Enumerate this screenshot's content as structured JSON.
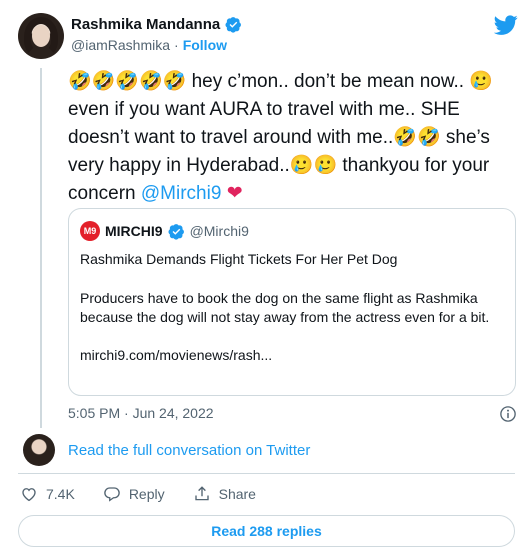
{
  "author": {
    "name": "Rashmika Mandanna",
    "handle": "@iamRashmika",
    "separator": "·",
    "follow_label": "Follow"
  },
  "tweet": {
    "line1_emoji": "🤣🤣🤣🤣🤣",
    "line1_text": " hey c’mon.. don’t be mean now.. ",
    "line2_emoji": "🥲",
    "line2_text": " even if you want AURA to travel with me.. SHE doesn’t want to travel around with me..",
    "line3_emoji": "🤣🤣",
    "line3_text": " she’s very happy in Hyderabad..",
    "line4_emoji": "🥲🥲",
    "line4_text": " thankyou for your concern ",
    "mention": "@Mirchi9",
    "heart": "❤"
  },
  "quote": {
    "logo": "M9",
    "name": "MIRCHI9",
    "handle": "@Mirchi9",
    "title": "Rashmika Demands Flight Tickets For Her Pet Dog",
    "body": "Producers have to book the dog on the same flight as Rashmika because the dog will not stay away from the actress even for a bit.",
    "link": "mirchi9.com/movienews/rash..."
  },
  "timestamp": "5:05 PM · Jun 24, 2022",
  "conversation_link": "Read the full conversation on Twitter",
  "actions": {
    "likes": "7.4K",
    "reply_label": "Reply",
    "share_label": "Share"
  },
  "read_replies_label": "Read 288 replies",
  "colors": {
    "accent": "#1d9bf0",
    "heart": "#e0245e",
    "brand_red": "#e3202a"
  }
}
